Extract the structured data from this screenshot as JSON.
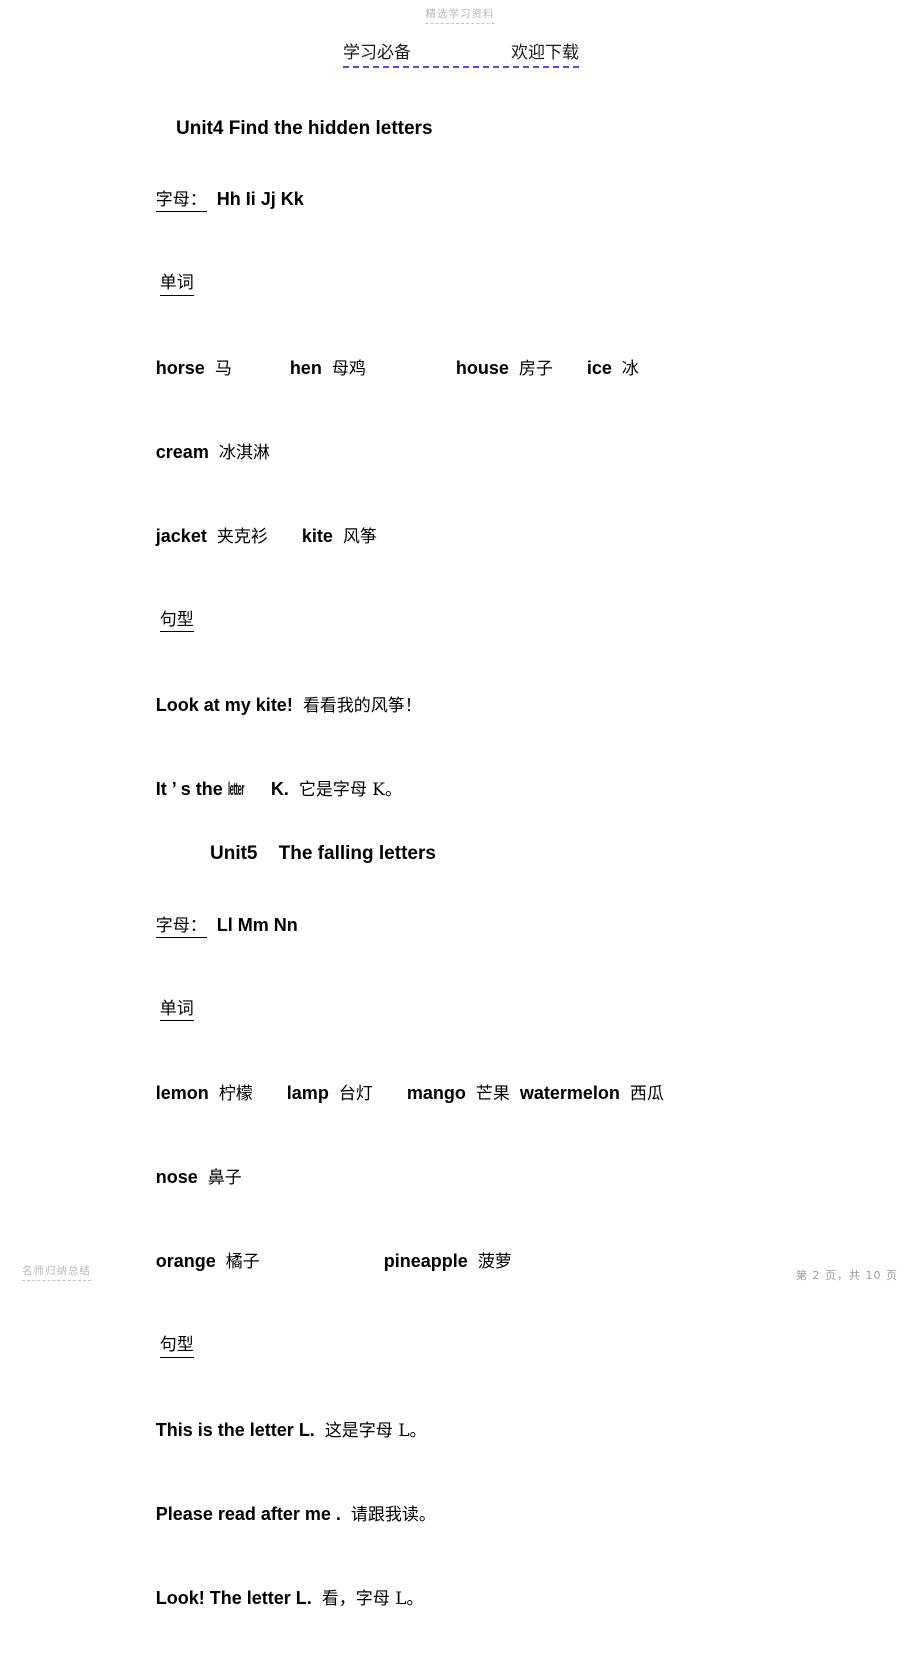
{
  "watermarks": {
    "top": "精选学习资料",
    "bottom_left": "名师归纳总结",
    "page_footer": "第 2 页，共 10 页"
  },
  "page_header": {
    "left": "学习必备",
    "right": "欢迎下载",
    "rule_color": "#4a4af0"
  },
  "units": [
    {
      "title": "Unit4 Find the hidden letters",
      "letters_label": "字母：",
      "letters": "Hh Ii Jj Kk",
      "words_label": "单词",
      "word_lines": [
        [
          {
            "en": "horse",
            "cn": "马"
          },
          {
            "en": "hen",
            "cn": "母鸡"
          },
          {
            "en": "house",
            "cn": "房子"
          },
          {
            "en": "ice",
            "cn": "冰"
          }
        ],
        [
          {
            "en": "cream",
            "cn": "冰淇淋"
          }
        ],
        [
          {
            "en": "jacket",
            "cn": "夹克衫"
          },
          {
            "en": "kite",
            "cn": "风筝"
          }
        ]
      ],
      "sentence_label": "句型",
      "sentences": [
        {
          "en": "Look at my kite!",
          "cn": "看看我的风筝！"
        },
        {
          "en_a": "It ’ s the ",
          "en_squish": "letter",
          "en_b": " K.",
          "cn": "它是字母 K。"
        }
      ]
    },
    {
      "title": "Unit5    The falling letters",
      "letters_label": "字母：",
      "letters": "Ll Mm Nn",
      "words_label": "单词",
      "word_lines": [
        [
          {
            "en": "lemon",
            "cn": "柠檬"
          },
          {
            "en": "lamp",
            "cn": "台灯"
          },
          {
            "en": "mango",
            "cn": "芒果"
          },
          {
            "en": "watermelon",
            "cn": "西瓜"
          }
        ],
        [
          {
            "en": "nose",
            "cn": "鼻子"
          }
        ],
        [
          {
            "en": "orange",
            "cn": "橘子"
          },
          {
            "en": "pineapple",
            "cn": "菠萝"
          }
        ]
      ],
      "sentence_label": "句型",
      "sentences": [
        {
          "en": "This is the letter L.",
          "cn": "这是字母 L。"
        },
        {
          "en": "Please read after me .",
          "cn": "请跟我读。"
        },
        {
          "en": "Look! The letter L.",
          "cn": "看，字母 L。"
        }
      ]
    }
  ]
}
